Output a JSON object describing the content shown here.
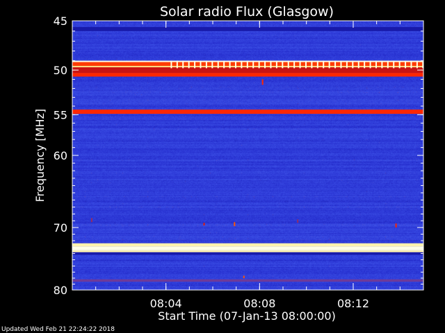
{
  "chart_data": {
    "type": "heatmap",
    "title": "Solar radio Flux (Glasgow)",
    "xlabel": "Start Time (07-Jan-13 08:00:00)",
    "ylabel": "Frequency [MHz]",
    "footer": "Updated Wed Feb 21 22:24:22 2018",
    "x_start_minutes": 0,
    "x_end_minutes": 15,
    "x_ticks": [
      {
        "minutes": 4,
        "label": "08:04"
      },
      {
        "minutes": 8,
        "label": "08:08"
      },
      {
        "minutes": 12,
        "label": "08:12"
      }
    ],
    "y_range_mhz": [
      45,
      80
    ],
    "y_axis_inverted": true,
    "y_scale": "logarithmic",
    "y_major_ticks": [
      {
        "mhz": 45,
        "label": "45"
      },
      {
        "mhz": 50,
        "label": "50"
      },
      {
        "mhz": 55,
        "label": "55"
      },
      {
        "mhz": 60,
        "label": "60"
      },
      {
        "mhz": 70,
        "label": "70"
      },
      {
        "mhz": 80,
        "label": "80"
      }
    ],
    "colormap": [
      "#000000",
      "#1414a0",
      "#2832d2",
      "#3c50e6",
      "#c81414",
      "#ff2800",
      "#ff8c00",
      "#fff0a0",
      "#ffffe6"
    ],
    "background_intensity": 0.3,
    "bands": [
      {
        "mhz_low": 45.6,
        "mhz_high": 46.0,
        "intensity": 0.15
      },
      {
        "mhz_low": 49.0,
        "mhz_high": 49.15,
        "intensity": 1.0
      },
      {
        "mhz_low": 49.15,
        "mhz_high": 49.55,
        "intensity": 0.65
      },
      {
        "mhz_low": 49.55,
        "mhz_high": 49.7,
        "intensity": 0.85
      },
      {
        "mhz_low": 49.7,
        "mhz_high": 50.3,
        "intensity": 0.5
      },
      {
        "mhz_low": 50.3,
        "mhz_high": 50.7,
        "intensity": 0.62
      },
      {
        "mhz_low": 54.4,
        "mhz_high": 54.9,
        "intensity": 0.62
      },
      {
        "mhz_low": 72.4,
        "mhz_high": 72.9,
        "intensity": 0.9
      },
      {
        "mhz_low": 72.9,
        "mhz_high": 73.5,
        "intensity": 1.0
      },
      {
        "mhz_low": 73.5,
        "mhz_high": 73.8,
        "intensity": 0.9
      },
      {
        "mhz_low": 73.8,
        "mhz_high": 74.2,
        "intensity": 0.15
      },
      {
        "mhz_low": 78.2,
        "mhz_high": 78.6,
        "intensity": 0.42
      }
    ],
    "spikes": [
      {
        "minutes": 8.1,
        "mhz_low": 51.0,
        "mhz_high": 51.6,
        "intensity": 0.62
      },
      {
        "minutes": 6.9,
        "mhz_low": 69.2,
        "mhz_high": 69.8,
        "intensity": 0.68
      },
      {
        "minutes": 7.3,
        "mhz_low": 77.6,
        "mhz_high": 78.0,
        "intensity": 0.68
      },
      {
        "minutes": 13.8,
        "mhz_low": 69.4,
        "mhz_high": 70.0,
        "intensity": 0.6
      },
      {
        "minutes": 5.6,
        "mhz_low": 69.3,
        "mhz_high": 69.7,
        "intensity": 0.55
      },
      {
        "minutes": 9.6,
        "mhz_low": 68.8,
        "mhz_high": 69.3,
        "intensity": 0.45
      },
      {
        "minutes": 0.8,
        "mhz_low": 68.6,
        "mhz_high": 69.2,
        "intensity": 0.45
      }
    ],
    "comb": {
      "mhz_low": 49.0,
      "mhz_high": 49.8,
      "start_minutes": 4.2,
      "end_minutes": 15,
      "period_minutes": 0.25,
      "intensity": 1.0
    }
  }
}
